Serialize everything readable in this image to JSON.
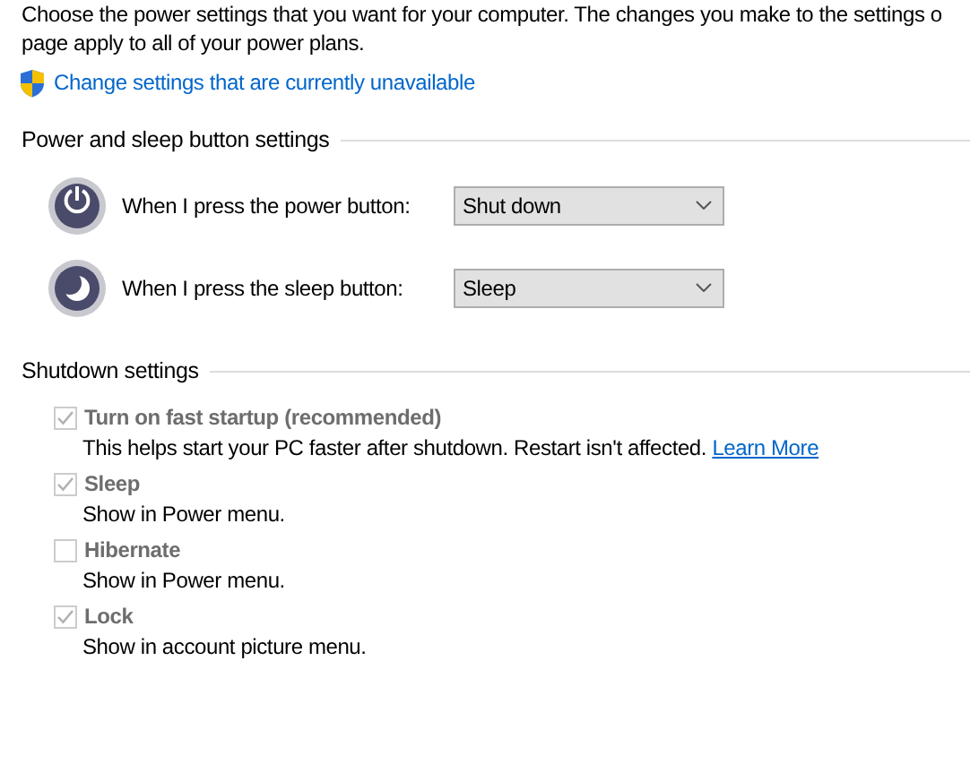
{
  "intro_lines": [
    "Choose the power settings that you want for your computer. The changes you make to the settings o",
    "page apply to all of your power plans."
  ],
  "admin_link": "Change settings that are currently unavailable",
  "button_section": {
    "title": "Power and sleep button settings",
    "rows": [
      {
        "kind": "power",
        "label": "When I press the power button:",
        "value": "Shut down"
      },
      {
        "kind": "sleep",
        "label": "When I press the sleep button:",
        "value": "Sleep"
      }
    ]
  },
  "shutdown_section": {
    "title": "Shutdown settings",
    "options": [
      {
        "label": "Turn on fast startup (recommended)",
        "checked": true,
        "disabled": true,
        "description": "This helps start your PC faster after shutdown. Restart isn't affected.",
        "link": "Learn More"
      },
      {
        "label": "Sleep",
        "checked": true,
        "disabled": true,
        "description": "Show in Power menu."
      },
      {
        "label": "Hibernate",
        "checked": false,
        "disabled": true,
        "description": "Show in Power menu."
      },
      {
        "label": "Lock",
        "checked": true,
        "disabled": true,
        "description": "Show in account picture menu."
      }
    ]
  }
}
